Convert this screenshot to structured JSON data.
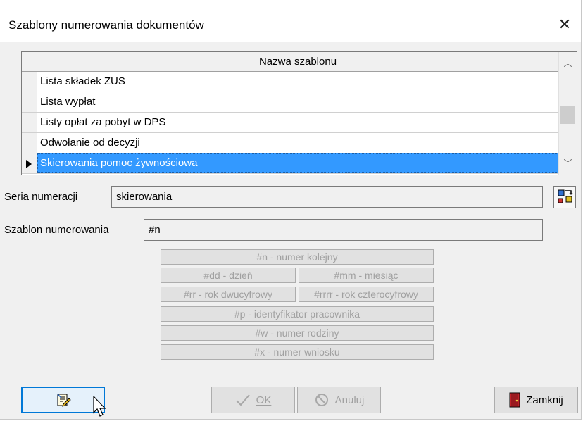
{
  "window": {
    "title": "Szablony numerowania dokumentów",
    "close_glyph": "✕"
  },
  "grid": {
    "column_header": "Nazwa szablonu",
    "rows": [
      {
        "label": "Lista składek ZUS"
      },
      {
        "label": "Lista wypłat"
      },
      {
        "label": "Listy opłat za pobyt w DPS"
      },
      {
        "label": "Odwołanie od decyzji"
      },
      {
        "label": "Skierowania pomoc żywnościowa"
      }
    ],
    "selected_index": 4,
    "scroll_up_glyph": "︿",
    "scroll_down_glyph": "﹀"
  },
  "series": {
    "label": "Seria numeracji",
    "value": "skierowania"
  },
  "template": {
    "label": "Szablon numerowania",
    "value": "#n"
  },
  "tokens": {
    "n": "#n - numer kolejny",
    "dd": "#dd - dzień",
    "mm": "#mm - miesiąc",
    "rr": "#rr - rok dwucyfrowy",
    "rrrr": "#rrrr - rok czterocyfrowy",
    "p": "#p - identyfikator pracownika",
    "w": "#w - numer rodziny",
    "x": "#x - numer wniosku"
  },
  "buttons": {
    "ok": {
      "label": "OK",
      "enabled": false
    },
    "cancel": {
      "label": "Anuluj",
      "enabled": false
    },
    "close": {
      "label": "Zamknij"
    }
  },
  "icons": {
    "edit": "edit-document-icon",
    "series_picker": "series-picker-icon",
    "ok": "checkmark-icon",
    "cancel": "cancel-circle-icon",
    "close": "exit-door-icon"
  },
  "colors": {
    "selection": "#3399ff",
    "focus_border": "#0078d7",
    "door": "#c0232a"
  }
}
